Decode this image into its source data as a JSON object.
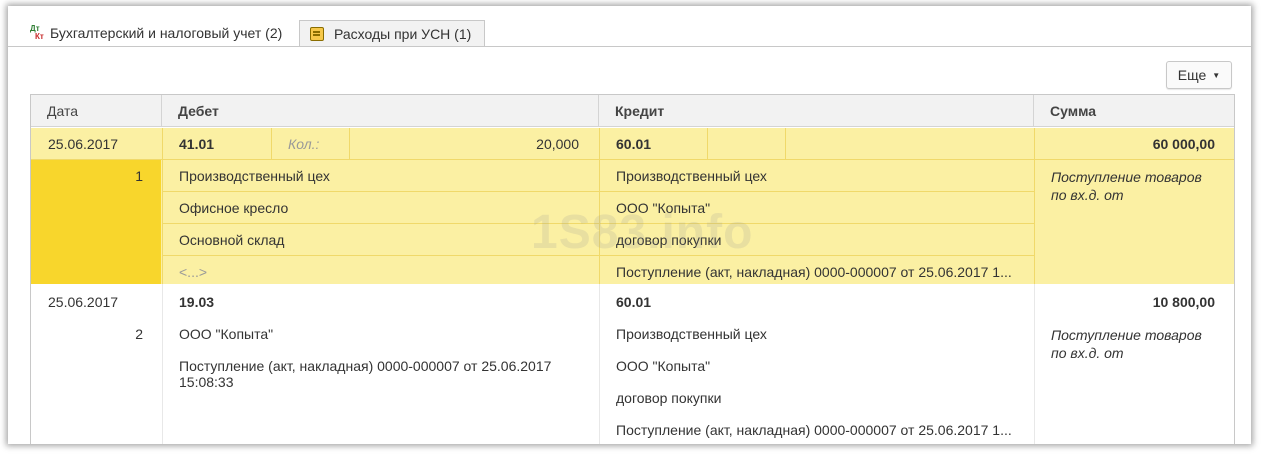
{
  "tabs": [
    {
      "label": "Бухгалтерский и налоговый учет (2)",
      "icon": "dt-kt-icon",
      "active": true
    },
    {
      "label": "Расходы при УСН (1)",
      "icon": "usn-icon",
      "active": false
    }
  ],
  "toolbar": {
    "more_label": "Еще"
  },
  "columns": {
    "date": "Дата",
    "debit": "Дебет",
    "credit": "Кредит",
    "sum": "Сумма"
  },
  "watermark": "1S83.info",
  "rows": [
    {
      "date": "25.06.2017",
      "num": "1",
      "debit_account": "41.01",
      "qty_label": "Кол.:",
      "qty": "20,000",
      "debit_subconto": [
        "Производственный цех",
        "Офисное кресло",
        "Основной склад",
        "<...>"
      ],
      "credit_account": "60.01",
      "credit_subconto": [
        "Производственный цех",
        "ООО \"Копыта\"",
        "договор покупки",
        "Поступление (акт, накладная) 0000-000007 от 25.06.2017 1..."
      ],
      "sum": "60 000,00",
      "comment": "Поступление товаров по вх.д.  от"
    },
    {
      "date": "25.06.2017",
      "num": "2",
      "debit_account": "19.03",
      "debit_subconto": [
        "ООО \"Копыта\"",
        "Поступление (акт, накладная) 0000-000007 от 25.06.2017",
        "15:08:33"
      ],
      "credit_account": "60.01",
      "credit_subconto": [
        "Производственный цех",
        "ООО \"Копыта\"",
        "договор покупки",
        "Поступление (акт, накладная) 0000-000007 от 25.06.2017 1..."
      ],
      "sum": "10 800,00",
      "comment": "Поступление товаров по вх.д.  от"
    }
  ]
}
